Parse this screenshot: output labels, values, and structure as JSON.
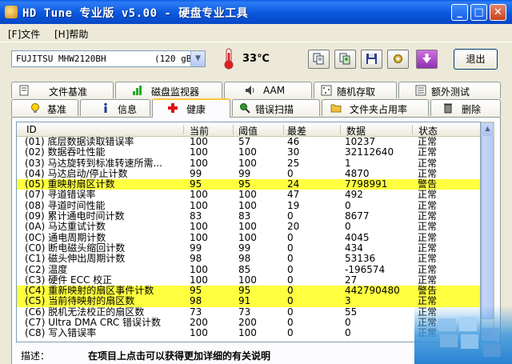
{
  "window": {
    "title": "HD Tune 专业版 v5.00 - 硬盘专业工具"
  },
  "menu": {
    "file": "[F]文件",
    "help": "[H]帮助"
  },
  "toolbar": {
    "drive_name": "FUJITSU MHW2120BH",
    "drive_capacity": "(120 gB)",
    "temperature": "33℃",
    "exit_label": "退出"
  },
  "tabs_row1": [
    {
      "label": "文件基准",
      "icon": "file-benchmark-icon"
    },
    {
      "label": "磁盘监视器",
      "icon": "disk-monitor-icon"
    },
    {
      "label": "AAM",
      "icon": "speaker-icon"
    },
    {
      "label": "随机存取",
      "icon": "random-access-icon"
    },
    {
      "label": "额外测试",
      "icon": "extra-tests-icon"
    }
  ],
  "tabs_row2": [
    {
      "label": "基准",
      "icon": "benchmark-icon"
    },
    {
      "label": "信息",
      "icon": "info-icon"
    },
    {
      "label": "健康",
      "icon": "health-icon"
    },
    {
      "label": "错误扫描",
      "icon": "error-scan-icon"
    },
    {
      "label": "文件夹占用率",
      "icon": "folder-usage-icon"
    },
    {
      "label": "删除",
      "icon": "erase-icon"
    }
  ],
  "table": {
    "headers": [
      "ID",
      "当前",
      "阈值",
      "最差",
      "数据",
      "状态"
    ],
    "rows": [
      {
        "id": "(01) 底层数据读取错误率",
        "cur": "100",
        "thr": "57",
        "worst": "46",
        "data": "10237",
        "state": "正常",
        "warn": false
      },
      {
        "id": "(02) 数据吞吐性能",
        "cur": "100",
        "thr": "100",
        "worst": "30",
        "data": "32112640",
        "state": "正常",
        "warn": false
      },
      {
        "id": "(03) 马达旋转到标准转速所需...",
        "cur": "100",
        "thr": "100",
        "worst": "25",
        "data": "1",
        "state": "正常",
        "warn": false
      },
      {
        "id": "(04) 马达启动/停止计数",
        "cur": "99",
        "thr": "99",
        "worst": "0",
        "data": "4870",
        "state": "正常",
        "warn": false
      },
      {
        "id": "(05) 重映射扇区计数",
        "cur": "95",
        "thr": "95",
        "worst": "24",
        "data": "7798991",
        "state": "警告",
        "warn": true
      },
      {
        "id": "(07) 寻道错误率",
        "cur": "100",
        "thr": "100",
        "worst": "47",
        "data": "492",
        "state": "正常",
        "warn": false
      },
      {
        "id": "(08) 寻道时间性能",
        "cur": "100",
        "thr": "100",
        "worst": "19",
        "data": "0",
        "state": "正常",
        "warn": false
      },
      {
        "id": "(09) 累计通电时间计数",
        "cur": "83",
        "thr": "83",
        "worst": "0",
        "data": "8677",
        "state": "正常",
        "warn": false
      },
      {
        "id": "(0A) 马达重试计数",
        "cur": "100",
        "thr": "100",
        "worst": "20",
        "data": "0",
        "state": "正常",
        "warn": false
      },
      {
        "id": "(0C) 通电周期计数",
        "cur": "100",
        "thr": "100",
        "worst": "0",
        "data": "4045",
        "state": "正常",
        "warn": false
      },
      {
        "id": "(C0) 断电磁头缩回计数",
        "cur": "99",
        "thr": "99",
        "worst": "0",
        "data": "434",
        "state": "正常",
        "warn": false
      },
      {
        "id": "(C1) 磁头伸出周期计数",
        "cur": "98",
        "thr": "98",
        "worst": "0",
        "data": "53136",
        "state": "正常",
        "warn": false
      },
      {
        "id": "(C2) 温度",
        "cur": "100",
        "thr": "85",
        "worst": "0",
        "data": "-196574",
        "state": "正常",
        "warn": false
      },
      {
        "id": "(C3) 硬件 ECC 校正",
        "cur": "100",
        "thr": "100",
        "worst": "0",
        "data": "27",
        "state": "正常",
        "warn": false
      },
      {
        "id": "(C4) 重新映射的扇区事件计数",
        "cur": "95",
        "thr": "95",
        "worst": "0",
        "data": "442790480",
        "state": "警告",
        "warn": true
      },
      {
        "id": "(C5) 当前待映射的扇区数",
        "cur": "98",
        "thr": "91",
        "worst": "0",
        "data": "3",
        "state": "正常",
        "warn": true
      },
      {
        "id": "(C6) 脱机无法校正的扇区数",
        "cur": "73",
        "thr": "73",
        "worst": "0",
        "data": "55",
        "state": "正常",
        "warn": false
      },
      {
        "id": "(C7) Ultra DMA CRC 错误计数",
        "cur": "200",
        "thr": "200",
        "worst": "0",
        "data": "0",
        "state": "正常",
        "warn": false
      },
      {
        "id": "(C8) 写入错误率",
        "cur": "100",
        "thr": "100",
        "worst": "0",
        "data": "0",
        "state": "正常",
        "warn": false
      }
    ]
  },
  "description": {
    "label": "描述：",
    "value": "在项目上点击可以获得更加详细的有关说明"
  }
}
